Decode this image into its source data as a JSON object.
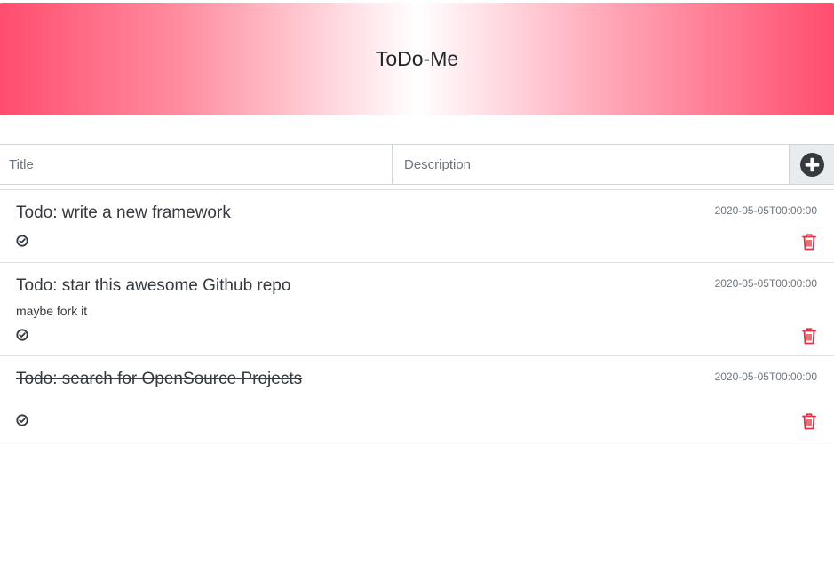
{
  "app": {
    "title": "ToDo-Me"
  },
  "form": {
    "title_placeholder": "Title",
    "title_value": "",
    "description_placeholder": "Description",
    "description_value": ""
  },
  "icons": {
    "add": "plus-circle-icon",
    "complete": "check-circle-icon",
    "delete": "trash-icon"
  },
  "colors": {
    "header_accent": "#ff4d6d",
    "delete": "#dc3545",
    "text": "#343a40",
    "muted": "#6c757d"
  },
  "todos": [
    {
      "title": "Todo: write a new framework",
      "description": "",
      "date": "2020-05-05T00:00:00",
      "completed": false
    },
    {
      "title": "Todo: star this awesome Github repo",
      "description": "maybe fork it",
      "date": "2020-05-05T00:00:00",
      "completed": false
    },
    {
      "title": "Todo: search for OpenSource Projects",
      "description": "",
      "date": "2020-05-05T00:00:00",
      "completed": true
    }
  ]
}
